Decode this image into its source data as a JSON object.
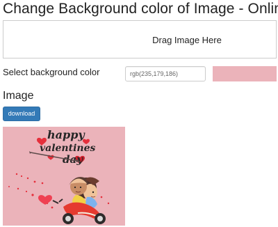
{
  "page": {
    "title": "Change Background color of Image - Online"
  },
  "dropzone": {
    "text": "Drag Image Here"
  },
  "background": {
    "label": "Select background color",
    "value": "rgb(235,179,186)",
    "swatch_color": "#ebb3ba"
  },
  "image_section": {
    "heading": "Image",
    "download_label": "download",
    "preview_text": {
      "line1": "happy",
      "line2": "valentines",
      "line3": "day"
    }
  }
}
